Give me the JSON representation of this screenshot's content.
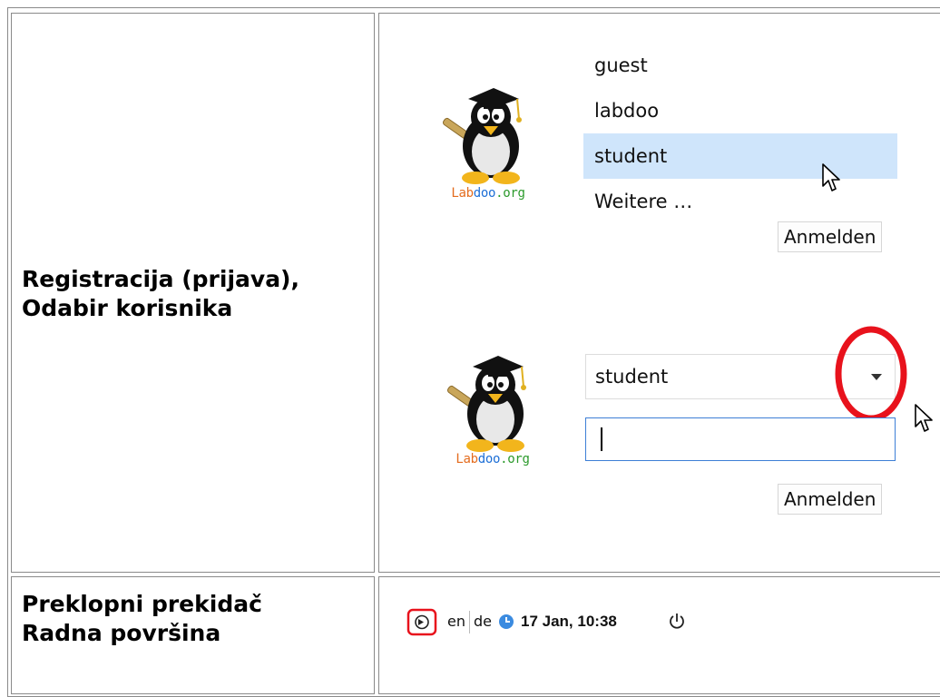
{
  "rows": {
    "login": {
      "label_line1": "Registracija (prijava),",
      "label_line2": "Odabir korisnika"
    },
    "switcher": {
      "label_line1": "Preklopni prekidač",
      "label_line2": "Radna površina"
    }
  },
  "logo": {
    "text_lab": "Lab",
    "text_doo": "doo",
    "text_org": ".org",
    "icon": "labdoo-penguin-logo"
  },
  "user_list": {
    "items": [
      {
        "label": "guest"
      },
      {
        "label": "labdoo"
      },
      {
        "label": "student"
      },
      {
        "label": "Weitere …"
      }
    ],
    "selected": "student",
    "login_button": "Anmelden"
  },
  "login_form": {
    "selected_user": "student",
    "password_value": "",
    "login_button": "Anmelden"
  },
  "taskbar": {
    "workspace_icon": "workspace-switcher-icon",
    "lang_1": "en",
    "lang_2": "de",
    "clock_icon": "clock-icon",
    "datetime": "17 Jan, 10:38",
    "power_icon": "power-icon"
  },
  "colors": {
    "selection": "#cfe5fb",
    "highlight_circle": "#e8121c",
    "input_focus": "#3d7fd6"
  }
}
